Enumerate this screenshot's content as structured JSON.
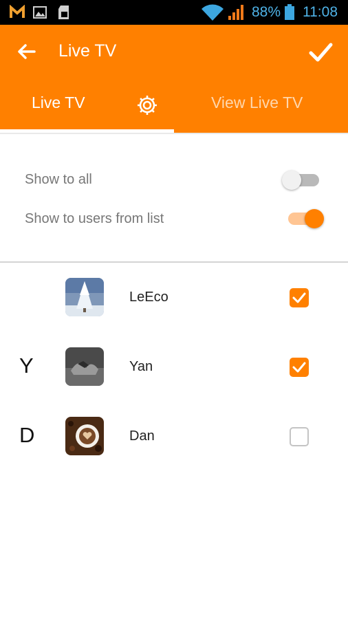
{
  "status_bar": {
    "battery_percent": "88%",
    "time": "11:08",
    "icons": [
      "m-app-icon",
      "image-icon",
      "sd-card-icon",
      "wifi-icon",
      "signal-icon",
      "battery-icon"
    ],
    "icon_color": "#4fb3e8"
  },
  "app_bar": {
    "title": "Live TV",
    "back_icon": "arrow-left-icon",
    "done_icon": "check-icon",
    "color": "#ff8000"
  },
  "tabs": [
    {
      "label": "Live TV",
      "selected": true
    },
    {
      "icon": "gear-icon"
    },
    {
      "label": "View Live TV",
      "selected": false
    }
  ],
  "settings": [
    {
      "label": "Show to all",
      "enabled": false
    },
    {
      "label": "Show to users from list",
      "enabled": true
    }
  ],
  "contacts": [
    {
      "section": "",
      "name": "LeEco",
      "avatar": "snowy-tree-photo",
      "checked": true
    },
    {
      "section": "Y",
      "name": "Yan",
      "avatar": "grayscale-splash-photo",
      "checked": true
    },
    {
      "section": "D",
      "name": "Dan",
      "avatar": "coffee-cup-photo",
      "checked": false
    }
  ]
}
